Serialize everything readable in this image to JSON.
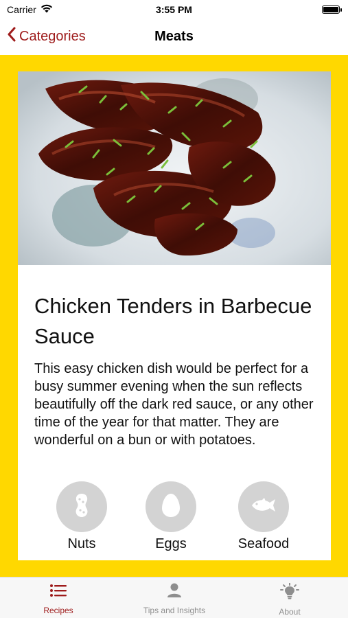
{
  "status_bar": {
    "carrier": "Carrier",
    "time": "3:55 PM"
  },
  "nav": {
    "back_label": "Categories",
    "title": "Meats"
  },
  "recipe": {
    "title": "Chicken Tenders in Barbecue Sauce",
    "description": "This easy chicken dish would be perfect for a busy summer evening when the sun reflects beautifully off the dark red sauce, or any other time of the year for that matter. They are wonderful on a bun or with potatoes.",
    "photo_subject": "barbecue chicken tenders garnished with chives on a plate"
  },
  "allergens": [
    {
      "label": "Nuts",
      "icon": "peanut-icon"
    },
    {
      "label": "Eggs",
      "icon": "egg-icon"
    },
    {
      "label": "Seafood",
      "icon": "fish-icon"
    }
  ],
  "tabs": [
    {
      "label": "Recipes",
      "icon": "list-icon",
      "active": true
    },
    {
      "label": "Tips and Insights",
      "icon": "person-icon",
      "active": false
    },
    {
      "label": "About",
      "icon": "lightbulb-icon",
      "active": false
    }
  ],
  "colors": {
    "accent": "#9e1b1b",
    "frame": "#ffd800",
    "allergen_bg": "#d3d3d3",
    "tab_inactive": "#8e8e8e"
  }
}
